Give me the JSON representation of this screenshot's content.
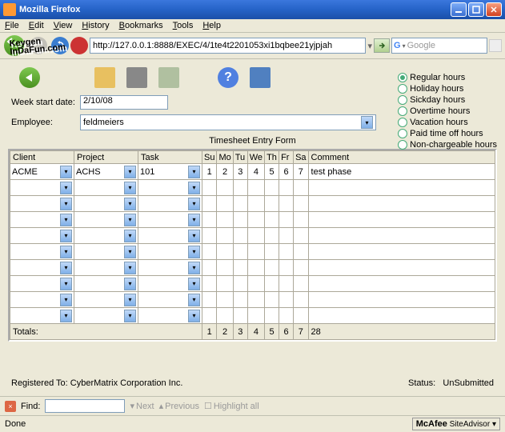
{
  "window": {
    "title": "Mozilla Firefox"
  },
  "menu": [
    "File",
    "Edit",
    "View",
    "History",
    "Bookmarks",
    "Tools",
    "Help"
  ],
  "toolbar": {
    "url": "http://127.0.0.1:8888/EXEC/4/1te4t2201053xi1bqbee21yjpjah",
    "search_placeholder": "Google"
  },
  "form": {
    "week_label": "Week start date:",
    "week_value": "2/10/08",
    "emp_label": "Employee:",
    "emp_value": "feldmeiers",
    "title": "Timesheet Entry Form"
  },
  "hours_types": [
    {
      "label": "Regular hours",
      "selected": true
    },
    {
      "label": "Holiday hours",
      "selected": false
    },
    {
      "label": "Sickday hours",
      "selected": false
    },
    {
      "label": "Overtime hours",
      "selected": false
    },
    {
      "label": "Vacation hours",
      "selected": false
    },
    {
      "label": "Paid time off hours",
      "selected": false
    },
    {
      "label": "Non-chargeable hours",
      "selected": false
    }
  ],
  "grid": {
    "headers": [
      "Client",
      "Project",
      "Task",
      "Su",
      "Mo",
      "Tu",
      "We",
      "Th",
      "Fr",
      "Sa",
      "Comment"
    ],
    "rows": [
      {
        "client": "ACME",
        "project": "ACHS",
        "task": "101",
        "days": [
          "1",
          "2",
          "3",
          "4",
          "5",
          "6",
          "7"
        ],
        "comment": "test phase"
      },
      {
        "client": "",
        "project": "",
        "task": "",
        "days": [
          "",
          "",
          "",
          "",
          "",
          "",
          ""
        ],
        "comment": ""
      },
      {
        "client": "",
        "project": "",
        "task": "",
        "days": [
          "",
          "",
          "",
          "",
          "",
          "",
          ""
        ],
        "comment": ""
      },
      {
        "client": "",
        "project": "",
        "task": "",
        "days": [
          "",
          "",
          "",
          "",
          "",
          "",
          ""
        ],
        "comment": ""
      },
      {
        "client": "",
        "project": "",
        "task": "",
        "days": [
          "",
          "",
          "",
          "",
          "",
          "",
          ""
        ],
        "comment": ""
      },
      {
        "client": "",
        "project": "",
        "task": "",
        "days": [
          "",
          "",
          "",
          "",
          "",
          "",
          ""
        ],
        "comment": ""
      },
      {
        "client": "",
        "project": "",
        "task": "",
        "days": [
          "",
          "",
          "",
          "",
          "",
          "",
          ""
        ],
        "comment": ""
      },
      {
        "client": "",
        "project": "",
        "task": "",
        "days": [
          "",
          "",
          "",
          "",
          "",
          "",
          ""
        ],
        "comment": ""
      },
      {
        "client": "",
        "project": "",
        "task": "",
        "days": [
          "",
          "",
          "",
          "",
          "",
          "",
          ""
        ],
        "comment": ""
      },
      {
        "client": "",
        "project": "",
        "task": "",
        "days": [
          "",
          "",
          "",
          "",
          "",
          "",
          ""
        ],
        "comment": ""
      }
    ],
    "totals_label": "Totals:",
    "totals": [
      "1",
      "2",
      "3",
      "4",
      "5",
      "6",
      "7",
      "28"
    ]
  },
  "footer": {
    "registered": "Registered To: CyberMatrix Corporation Inc.",
    "status_label": "Status:",
    "status_value": "UnSubmitted"
  },
  "findbar": {
    "label": "Find:",
    "next": "Next",
    "previous": "Previous",
    "highlight": "Highlight all"
  },
  "statusbar": {
    "done": "Done",
    "mcafee": "McAfee SiteAdvisor"
  },
  "watermark": {
    "line1": "Keygen",
    "line2": "InDaFun.com"
  }
}
